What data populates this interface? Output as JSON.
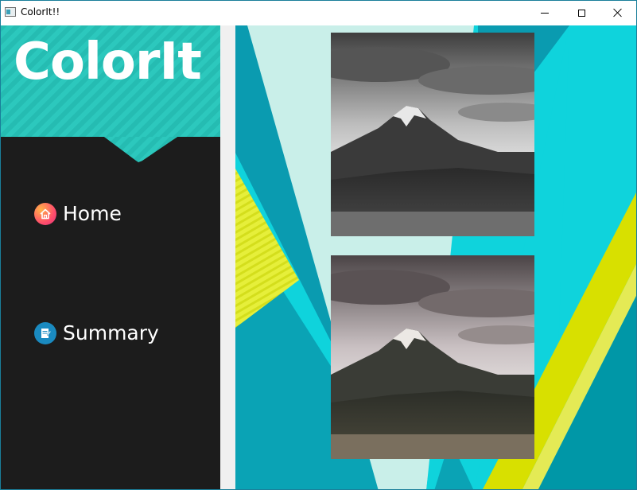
{
  "window": {
    "title": "ColorIt!!"
  },
  "sidebar": {
    "logo": "ColorIt",
    "items": [
      {
        "label": "Home",
        "icon": "home-icon"
      },
      {
        "label": "Summary",
        "icon": "document-icon"
      }
    ]
  },
  "colors": {
    "sidebar_bg": "#1c1c1c",
    "header_teal": "#25bcb2",
    "main_cyan": "#0fd3dc",
    "deep_teal": "#0097a7",
    "pale_mint": "#c9efe9",
    "yellow": "#d8e000"
  }
}
